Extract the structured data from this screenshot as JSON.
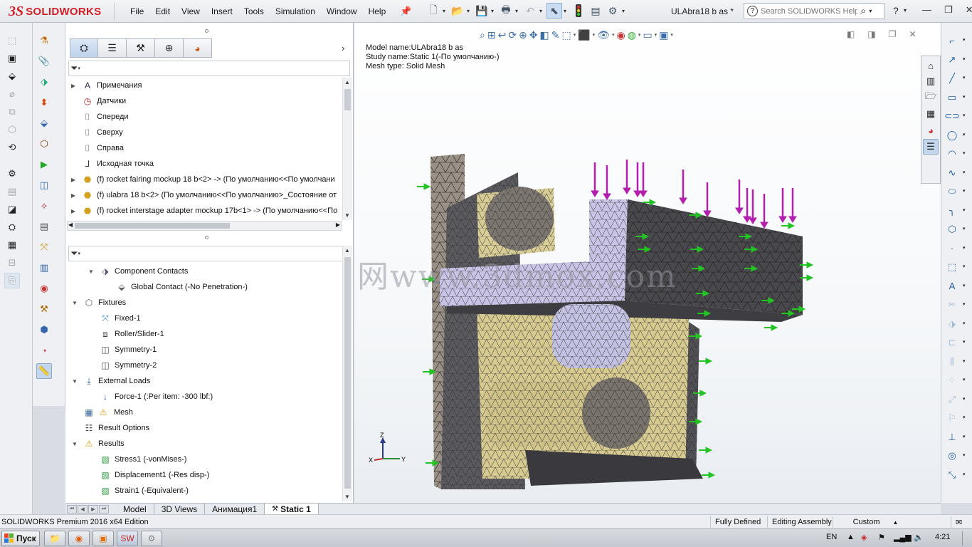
{
  "app": {
    "brand_prefix": "3S",
    "brand_name": "SOLIDWORKS",
    "document_title": "ULAbra18 b as *",
    "help_search_placeholder": "Search SOLIDWORKS Help"
  },
  "menu": [
    "File",
    "Edit",
    "View",
    "Insert",
    "Tools",
    "Simulation",
    "Window",
    "Help"
  ],
  "feature_tree": [
    {
      "label": "Примечания",
      "icon": "annotation-icon",
      "expand": "right"
    },
    {
      "label": "Датчики",
      "icon": "sensor-icon",
      "expand": ""
    },
    {
      "label": "Спереди",
      "icon": "plane-icon",
      "expand": ""
    },
    {
      "label": "Сверху",
      "icon": "plane-icon",
      "expand": ""
    },
    {
      "label": "Справа",
      "icon": "plane-icon",
      "expand": ""
    },
    {
      "label": "Исходная точка",
      "icon": "origin-icon",
      "expand": ""
    },
    {
      "label": "(f) rocket fairing mockup 18 b<2> -> (По умолчанию<<По умолчани",
      "icon": "part-icon",
      "expand": "right"
    },
    {
      "label": "(f) ulabra 18 b<2> (По умолчанию<<По умолчанию>_Состояние от",
      "icon": "part-icon",
      "expand": "right"
    },
    {
      "label": "(f) rocket interstage adapter mockup 17b<1> -> (По умолчанию<<По",
      "icon": "part-icon",
      "expand": "right"
    }
  ],
  "study_tree": [
    {
      "label": "Component Contacts",
      "icon": "contacts-icon",
      "expand": "down",
      "level": 1
    },
    {
      "label": "Global Contact (-No Penetration-)",
      "icon": "global-contact-icon",
      "expand": "",
      "level": 2
    },
    {
      "label": "Fixtures",
      "icon": "fixtures-icon",
      "expand": "down",
      "level": 0
    },
    {
      "label": "Fixed-1",
      "icon": "fixed-icon",
      "expand": "",
      "level": 1
    },
    {
      "label": "Roller/Slider-1",
      "icon": "roller-icon",
      "expand": "",
      "level": 1
    },
    {
      "label": "Symmetry-1",
      "icon": "symmetry-icon",
      "expand": "",
      "level": 1
    },
    {
      "label": "Symmetry-2",
      "icon": "symmetry-icon",
      "expand": "",
      "level": 1
    },
    {
      "label": "External Loads",
      "icon": "external-loads-icon",
      "expand": "down",
      "level": 0
    },
    {
      "label": "Force-1 (:Per item: -300 lbf:)",
      "icon": "force-icon",
      "expand": "",
      "level": 1
    },
    {
      "label": "Mesh",
      "icon": "mesh-icon",
      "expand": "",
      "level": 0
    },
    {
      "label": "Result Options",
      "icon": "result-options-icon",
      "expand": "",
      "level": 0
    },
    {
      "label": "Results",
      "icon": "results-icon",
      "expand": "down",
      "level": 0
    },
    {
      "label": "Stress1 (-vonMises-)",
      "icon": "plot-icon",
      "expand": "",
      "level": 1
    },
    {
      "label": "Displacement1 (-Res disp-)",
      "icon": "plot-icon",
      "expand": "",
      "level": 1
    },
    {
      "label": "Strain1 (-Equivalent-)",
      "icon": "plot-icon",
      "expand": "",
      "level": 1
    }
  ],
  "viewport": {
    "model_name": "Model name:ULAbra18 b as",
    "study_name": "Study name:Static 1(-По умолчанию-)",
    "mesh_type": "Mesh type: Solid Mesh",
    "watermark": "莫西网www.3dmox.com",
    "triad": {
      "z": "Z",
      "y": "Y",
      "x": "X"
    }
  },
  "bottom_tabs": [
    {
      "label": "Model",
      "active": false
    },
    {
      "label": "3D Views",
      "active": false
    },
    {
      "label": "Анимация1",
      "active": false
    },
    {
      "label": "Static 1",
      "active": true
    }
  ],
  "status": {
    "edition": "SOLIDWORKS Premium 2016 x64 Edition",
    "defined": "Fully Defined",
    "mode": "Editing Assembly",
    "units": "Custom"
  },
  "taskbar": {
    "start_label": "Пуск",
    "language": "EN",
    "clock": "4:21"
  },
  "colors": {
    "brand_red": "#d41f26",
    "load_arrow": "#b51fb0",
    "fixture_arrow": "#22c322",
    "mesh_part_light": "#c9c4e6",
    "mesh_part_tan": "#d9cf9a",
    "mesh_part_dark": "#4a4a50"
  }
}
